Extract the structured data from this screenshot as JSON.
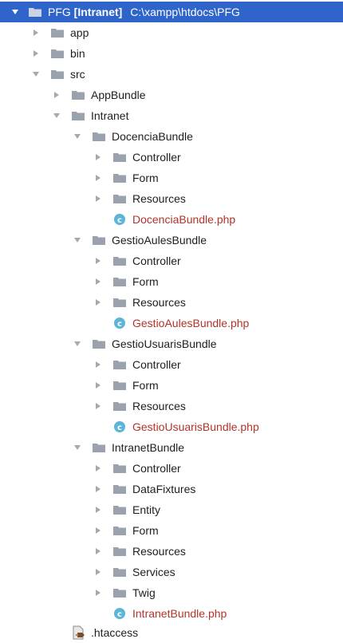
{
  "project": {
    "name": "PFG",
    "tag": "[Intranet]",
    "path": "C:\\xampp\\htdocs\\PFG"
  },
  "items": [
    {
      "label": "app"
    },
    {
      "label": "bin"
    },
    {
      "label": "src"
    },
    {
      "label": "AppBundle"
    },
    {
      "label": "Intranet"
    },
    {
      "label": "DocenciaBundle"
    },
    {
      "label": "Controller"
    },
    {
      "label": "Form"
    },
    {
      "label": "Resources"
    },
    {
      "label": "DocenciaBundle.php"
    },
    {
      "label": "GestioAulesBundle"
    },
    {
      "label": "Controller"
    },
    {
      "label": "Form"
    },
    {
      "label": "Resources"
    },
    {
      "label": "GestioAulesBundle.php"
    },
    {
      "label": "GestioUsuarisBundle"
    },
    {
      "label": "Controller"
    },
    {
      "label": "Form"
    },
    {
      "label": "Resources"
    },
    {
      "label": "GestioUsuarisBundle.php"
    },
    {
      "label": "IntranetBundle"
    },
    {
      "label": "Controller"
    },
    {
      "label": "DataFixtures"
    },
    {
      "label": "Entity"
    },
    {
      "label": "Form"
    },
    {
      "label": "Resources"
    },
    {
      "label": "Services"
    },
    {
      "label": "Twig"
    },
    {
      "label": "IntranetBundle.php"
    },
    {
      "label": ".htaccess"
    }
  ],
  "colors": {
    "selection": "#2f65ca",
    "php_file": "#b0342a",
    "folder": "#9aa3ad",
    "class_icon": "#5bb5d6"
  },
  "icons": {
    "folder": "folder-icon",
    "php_class": "php-class-icon",
    "htaccess": "htaccess-file-icon",
    "expanded": "chevron-down-icon",
    "collapsed": "chevron-right-icon"
  }
}
